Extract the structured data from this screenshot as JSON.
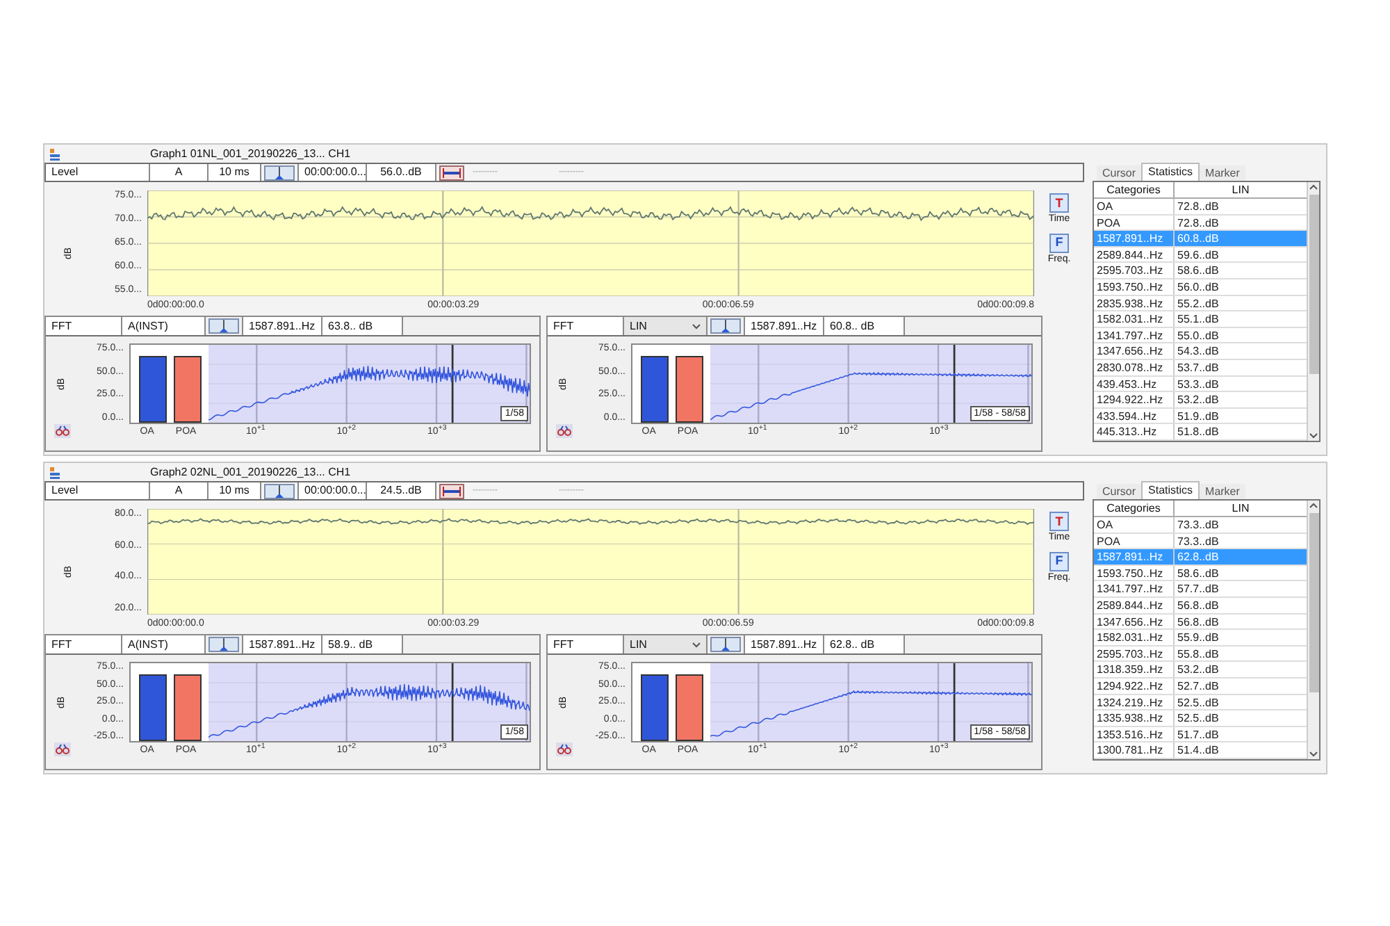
{
  "graphs": [
    {
      "title": "Graph1 01NL_001_20190226_13... CH1",
      "toolbar": {
        "mode": "Level",
        "weighting": "A",
        "interval": "10 ms",
        "time": "00:00:00.0...",
        "value": "56.0..dB",
        "field_1": "---------",
        "field_2": "---------"
      },
      "level_chart": {
        "unit": "dB",
        "yticks": [
          "75.0...",
          "70.0...",
          "65.0...",
          "60.0...",
          "55.0..."
        ],
        "xticks": [
          "0d00:00:00.0",
          "00:00:03.29",
          "00:00:06.59",
          "0d00:00:09.8"
        ]
      },
      "view_buttons": [
        {
          "kind": "time",
          "icon": "T",
          "label": "Time"
        },
        {
          "kind": "freq",
          "icon": "F",
          "label": "Freq."
        }
      ],
      "fft": [
        {
          "mode": "FFT",
          "weighting": "A(INST)",
          "dropdown": false,
          "frequency": "1587.891..Hz",
          "value": "63.8.. dB",
          "unit": "dB",
          "yticks": [
            "75.0...",
            "50.0...",
            "25.0...",
            "0.0..."
          ],
          "bars": [
            "OA",
            "POA"
          ],
          "xticks": [
            "10$^{+1}$",
            "10$^{+2}$",
            "10$^{+3}$"
          ],
          "page": "1/58"
        },
        {
          "mode": "FFT",
          "weighting": "LIN",
          "dropdown": true,
          "frequency": "1587.891..Hz",
          "value": "60.8.. dB",
          "unit": "dB",
          "yticks": [
            "75.0...",
            "50.0...",
            "25.0...",
            "0.0..."
          ],
          "bars": [
            "OA",
            "POA"
          ],
          "xticks": [
            "10$^{+1}$",
            "10$^{+2}$",
            "10$^{+3}$"
          ],
          "page": "1/58 - 58/58"
        }
      ],
      "stats": {
        "tabs": [
          {
            "label": "Cursor",
            "selected": false
          },
          {
            "label": "Statistics",
            "selected": true
          },
          {
            "label": "Marker",
            "selected": false
          }
        ],
        "columns": [
          "Categories",
          "LIN"
        ],
        "rows": [
          {
            "category": "OA",
            "value": "72.8..dB",
            "selected": false
          },
          {
            "category": "POA",
            "value": "72.8..dB",
            "selected": false
          },
          {
            "category": "1587.891..Hz",
            "value": "60.8..dB",
            "selected": true
          },
          {
            "category": "2589.844..Hz",
            "value": "59.6..dB",
            "selected": false
          },
          {
            "category": "2595.703..Hz",
            "value": "58.6..dB",
            "selected": false
          },
          {
            "category": "1593.750..Hz",
            "value": "56.0..dB",
            "selected": false
          },
          {
            "category": "2835.938..Hz",
            "value": "55.2..dB",
            "selected": false
          },
          {
            "category": "1582.031..Hz",
            "value": "55.1..dB",
            "selected": false
          },
          {
            "category": "1341.797..Hz",
            "value": "55.0..dB",
            "selected": false
          },
          {
            "category": "1347.656..Hz",
            "value": "54.3..dB",
            "selected": false
          },
          {
            "category": "2830.078..Hz",
            "value": "53.7..dB",
            "selected": false
          },
          {
            "category": "439.453..Hz",
            "value": "53.3..dB",
            "selected": false
          },
          {
            "category": "1294.922..Hz",
            "value": "53.2..dB",
            "selected": false
          },
          {
            "category": "433.594..Hz",
            "value": "51.9..dB",
            "selected": false
          },
          {
            "category": "445.313..Hz",
            "value": "51.8..dB",
            "selected": false
          }
        ]
      }
    },
    {
      "title": "Graph2 02NL_001_20190226_13... CH1",
      "toolbar": {
        "mode": "Level",
        "weighting": "A",
        "interval": "10 ms",
        "time": "00:00:00.0...",
        "value": "24.5..dB",
        "field_1": "---------",
        "field_2": "---------"
      },
      "level_chart": {
        "unit": "dB",
        "yticks": [
          "80.0...",
          "60.0...",
          "40.0...",
          "20.0..."
        ],
        "xticks": [
          "0d00:00:00.0",
          "00:00:03.29",
          "00:00:06.59",
          "0d00:00:09.8"
        ]
      },
      "view_buttons": [
        {
          "kind": "time",
          "icon": "T",
          "label": "Time"
        },
        {
          "kind": "freq",
          "icon": "F",
          "label": "Freq."
        }
      ],
      "fft": [
        {
          "mode": "FFT",
          "weighting": "A(INST)",
          "dropdown": false,
          "frequency": "1587.891..Hz",
          "value": "58.9.. dB",
          "unit": "dB",
          "yticks": [
            "75.0...",
            "50.0...",
            "25.0...",
            "0.0...",
            "-25.0..."
          ],
          "bars": [
            "OA",
            "POA"
          ],
          "xticks": [
            "10$^{+1}$",
            "10$^{+2}$",
            "10$^{+3}$"
          ],
          "page": "1/58"
        },
        {
          "mode": "FFT",
          "weighting": "LIN",
          "dropdown": true,
          "frequency": "1587.891..Hz",
          "value": "62.8.. dB",
          "unit": "dB",
          "yticks": [
            "75.0...",
            "50.0...",
            "25.0...",
            "0.0...",
            "-25.0..."
          ],
          "bars": [
            "OA",
            "POA"
          ],
          "xticks": [
            "10$^{+1}$",
            "10$^{+2}$",
            "10$^{+3}$"
          ],
          "page": "1/58 - 58/58"
        }
      ],
      "stats": {
        "tabs": [
          {
            "label": "Cursor",
            "selected": false
          },
          {
            "label": "Statistics",
            "selected": true
          },
          {
            "label": "Marker",
            "selected": false
          }
        ],
        "columns": [
          "Categories",
          "LIN"
        ],
        "rows": [
          {
            "category": "OA",
            "value": "73.3..dB",
            "selected": false
          },
          {
            "category": "POA",
            "value": "73.3..dB",
            "selected": false
          },
          {
            "category": "1587.891..Hz",
            "value": "62.8..dB",
            "selected": true
          },
          {
            "category": "1593.750..Hz",
            "value": "58.6..dB",
            "selected": false
          },
          {
            "category": "1341.797..Hz",
            "value": "57.7..dB",
            "selected": false
          },
          {
            "category": "2589.844..Hz",
            "value": "56.8..dB",
            "selected": false
          },
          {
            "category": "1347.656..Hz",
            "value": "56.8..dB",
            "selected": false
          },
          {
            "category": "1582.031..Hz",
            "value": "55.9..dB",
            "selected": false
          },
          {
            "category": "2595.703..Hz",
            "value": "55.8..dB",
            "selected": false
          },
          {
            "category": "1318.359..Hz",
            "value": "53.2..dB",
            "selected": false
          },
          {
            "category": "1294.922..Hz",
            "value": "52.7..dB",
            "selected": false
          },
          {
            "category": "1324.219..Hz",
            "value": "52.5..dB",
            "selected": false
          },
          {
            "category": "1335.938..Hz",
            "value": "52.5..dB",
            "selected": false
          },
          {
            "category": "1353.516..Hz",
            "value": "51.7..dB",
            "selected": false
          },
          {
            "category": "1300.781..Hz",
            "value": "51.4..dB",
            "selected": false
          }
        ]
      }
    }
  ]
}
